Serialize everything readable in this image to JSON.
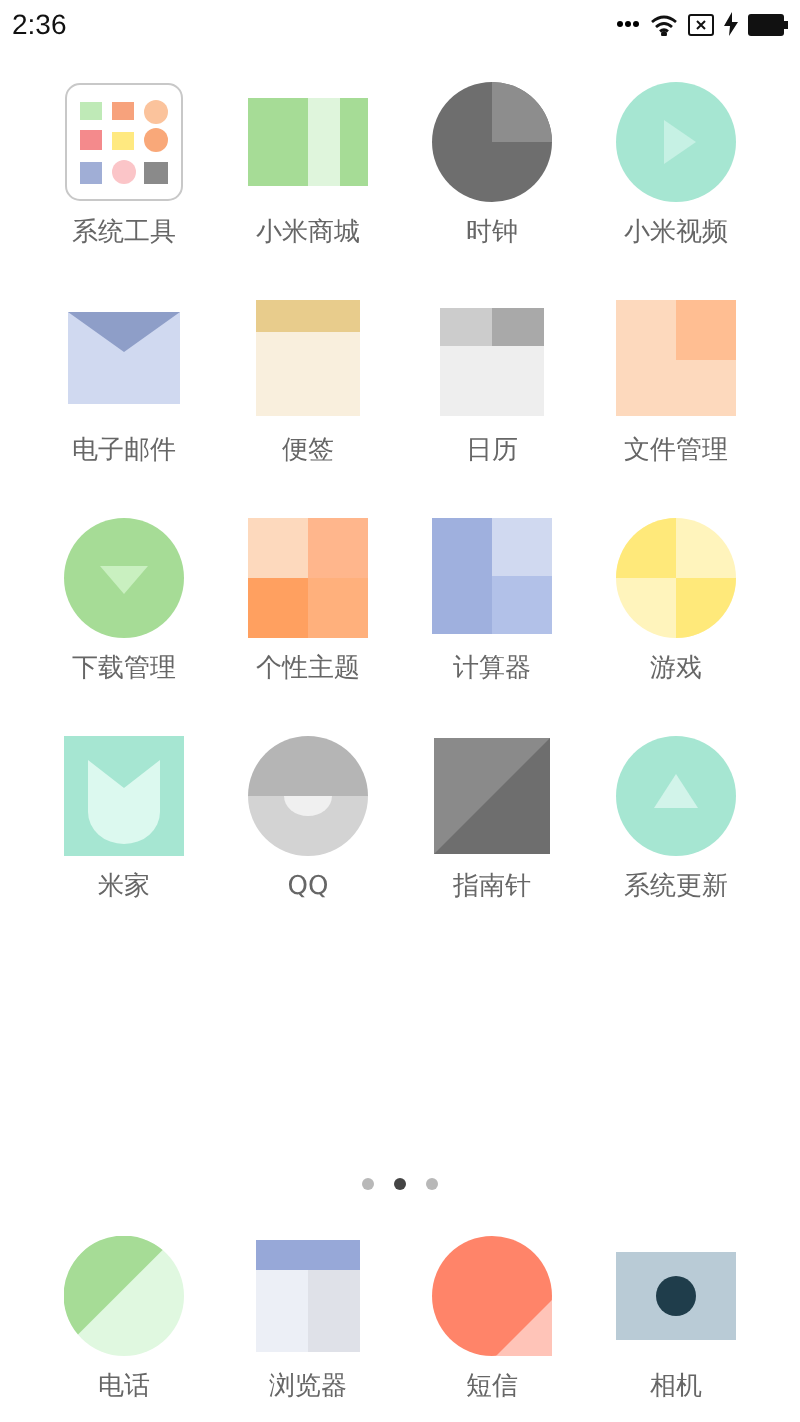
{
  "status_bar": {
    "time": "2:36"
  },
  "apps": [
    {
      "label": "系统工具",
      "kind": "tools"
    },
    {
      "label": "小米商城",
      "kind": "mall"
    },
    {
      "label": "时钟",
      "kind": "clock"
    },
    {
      "label": "小米视频",
      "kind": "video"
    },
    {
      "label": "电子邮件",
      "kind": "mail"
    },
    {
      "label": "便签",
      "kind": "notes"
    },
    {
      "label": "日历",
      "kind": "calendar"
    },
    {
      "label": "文件管理",
      "kind": "files"
    },
    {
      "label": "下载管理",
      "kind": "download"
    },
    {
      "label": "个性主题",
      "kind": "themes"
    },
    {
      "label": "计算器",
      "kind": "calculator"
    },
    {
      "label": "游戏",
      "kind": "games"
    },
    {
      "label": "米家",
      "kind": "home"
    },
    {
      "label": "QQ",
      "kind": "qq"
    },
    {
      "label": "指南针",
      "kind": "compass"
    },
    {
      "label": "系统更新",
      "kind": "update"
    }
  ],
  "page_indicator": [
    {
      "selected": false
    },
    {
      "selected": true
    },
    {
      "selected": false
    }
  ],
  "dock": [
    {
      "label": "电话",
      "kind": "phone"
    },
    {
      "label": "浏览器",
      "kind": "browser"
    },
    {
      "label": "短信",
      "kind": "sms"
    },
    {
      "label": "相机",
      "kind": "camera"
    }
  ]
}
